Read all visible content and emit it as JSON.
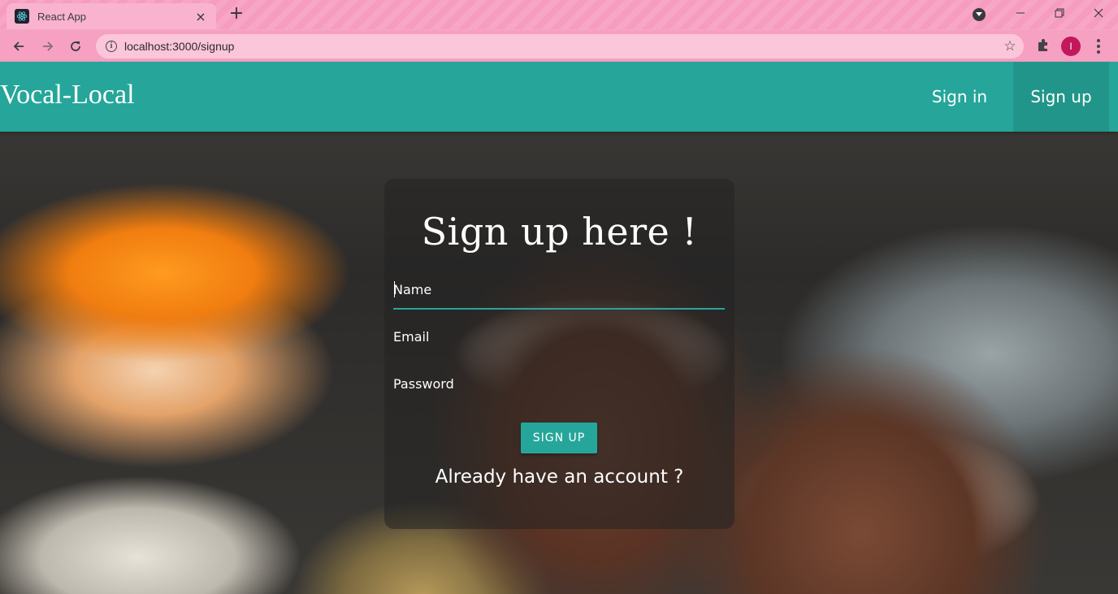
{
  "browser": {
    "tab_title": "React App",
    "tab_close": "×",
    "new_tab": "+",
    "url": "localhost:3000/signup",
    "profile_initial": "I",
    "window_controls": {
      "minimize": "─",
      "restore": "❐",
      "close": "✕"
    }
  },
  "app": {
    "brand": "Vocal-Local",
    "nav": [
      {
        "label": "Sign in",
        "active": false
      },
      {
        "label": "Sign up",
        "active": true
      }
    ],
    "accent_color": "#26a69a"
  },
  "signup_form": {
    "title": "Sign up here !",
    "fields": [
      {
        "label": "Name",
        "value": "",
        "focused": true
      },
      {
        "label": "Email",
        "value": ""
      },
      {
        "label": "Password",
        "value": ""
      }
    ],
    "submit_label": "SIGN UP",
    "footer_text": "Already have an account ?"
  }
}
